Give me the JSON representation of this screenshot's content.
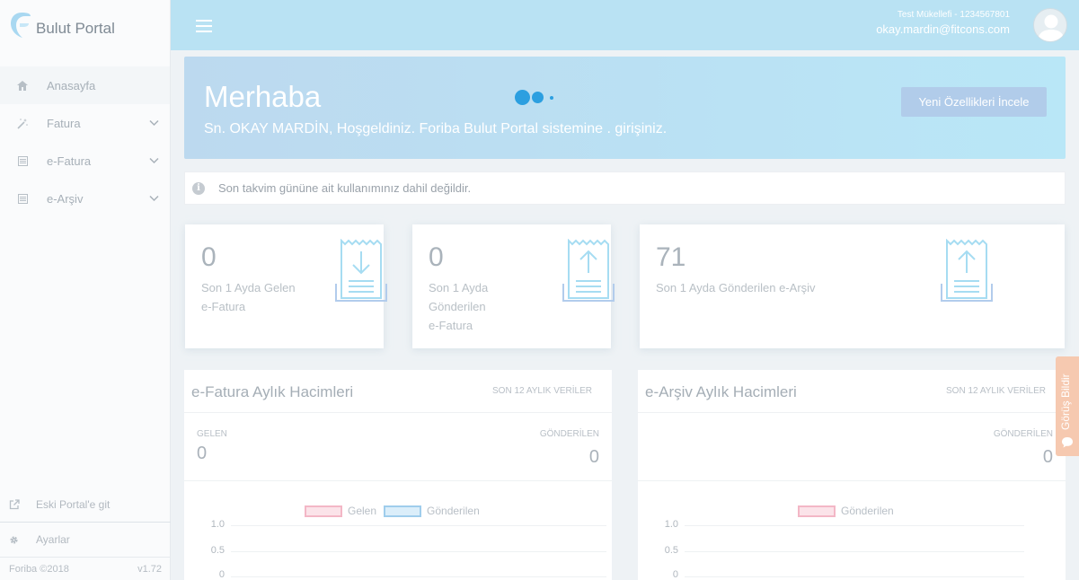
{
  "brand": {
    "name": "Bulut Portal"
  },
  "sidebar": {
    "items": [
      {
        "label": "Anasayfa"
      },
      {
        "label": "Fatura"
      },
      {
        "label": "e-Fatura"
      },
      {
        "label": "e-Arşiv"
      }
    ],
    "old_portal": "Eski Portal'e git",
    "settings": "Ayarlar",
    "copyright": "Foriba ©2018",
    "version": "v1.72"
  },
  "topbar": {
    "company": "Test Mükellefi - 1234567801",
    "email": "okay.mardin@fitcons.com"
  },
  "hero": {
    "title": "Merhaba",
    "user_name": "Sn. OKAY MARDİN,",
    "welcome": " Hoşgeldiniz. Foriba Bulut Portal sistemine . girişiniz.",
    "button": "Yeni Özellikleri İncele"
  },
  "alert": {
    "text": "Son takvim gününe ait kullanımınız dahil değildir."
  },
  "stats": [
    {
      "value": "0",
      "label_lines": [
        "Son 1 Ayda Gelen",
        "e-Fatura"
      ]
    },
    {
      "value": "0",
      "label_lines": [
        "Son 1 Ayda",
        "Gönderilen",
        "e-Fatura"
      ]
    },
    {
      "value": "71",
      "label_lines": [
        "Son 1 Ayda Gönderilen e-Arşiv"
      ]
    }
  ],
  "panels": {
    "efatura": {
      "title": "e-Fatura Aylık Hacimleri",
      "tag": "SON 12 AYLIK VERİLER",
      "incoming_label": "GELEN",
      "incoming_value": "0",
      "outgoing_label": "GÖNDERİLEN",
      "outgoing_value": "0",
      "legend": [
        "Gelen",
        "Gönderilen"
      ],
      "ticks": [
        "1.0",
        "0.5",
        "0"
      ]
    },
    "earsiv": {
      "title": "e-Arşiv Aylık Hacimleri",
      "tag": "SON 12 AYLIK VERİLER",
      "outgoing_label": "GÖNDERİLEN",
      "outgoing_value": "0",
      "legend": [
        "Gönderilen"
      ],
      "ticks": [
        "1.0",
        "0.5",
        "0"
      ]
    }
  },
  "feedback": {
    "label": "Görüş Bildir"
  },
  "colors": {
    "topbar": "#b9e2f3",
    "gelen_legend": "#f3b7c6",
    "gonderilen_legend": "#9fcdec",
    "loader": "#2c9fe0",
    "feedback": "#f6c9b0"
  }
}
